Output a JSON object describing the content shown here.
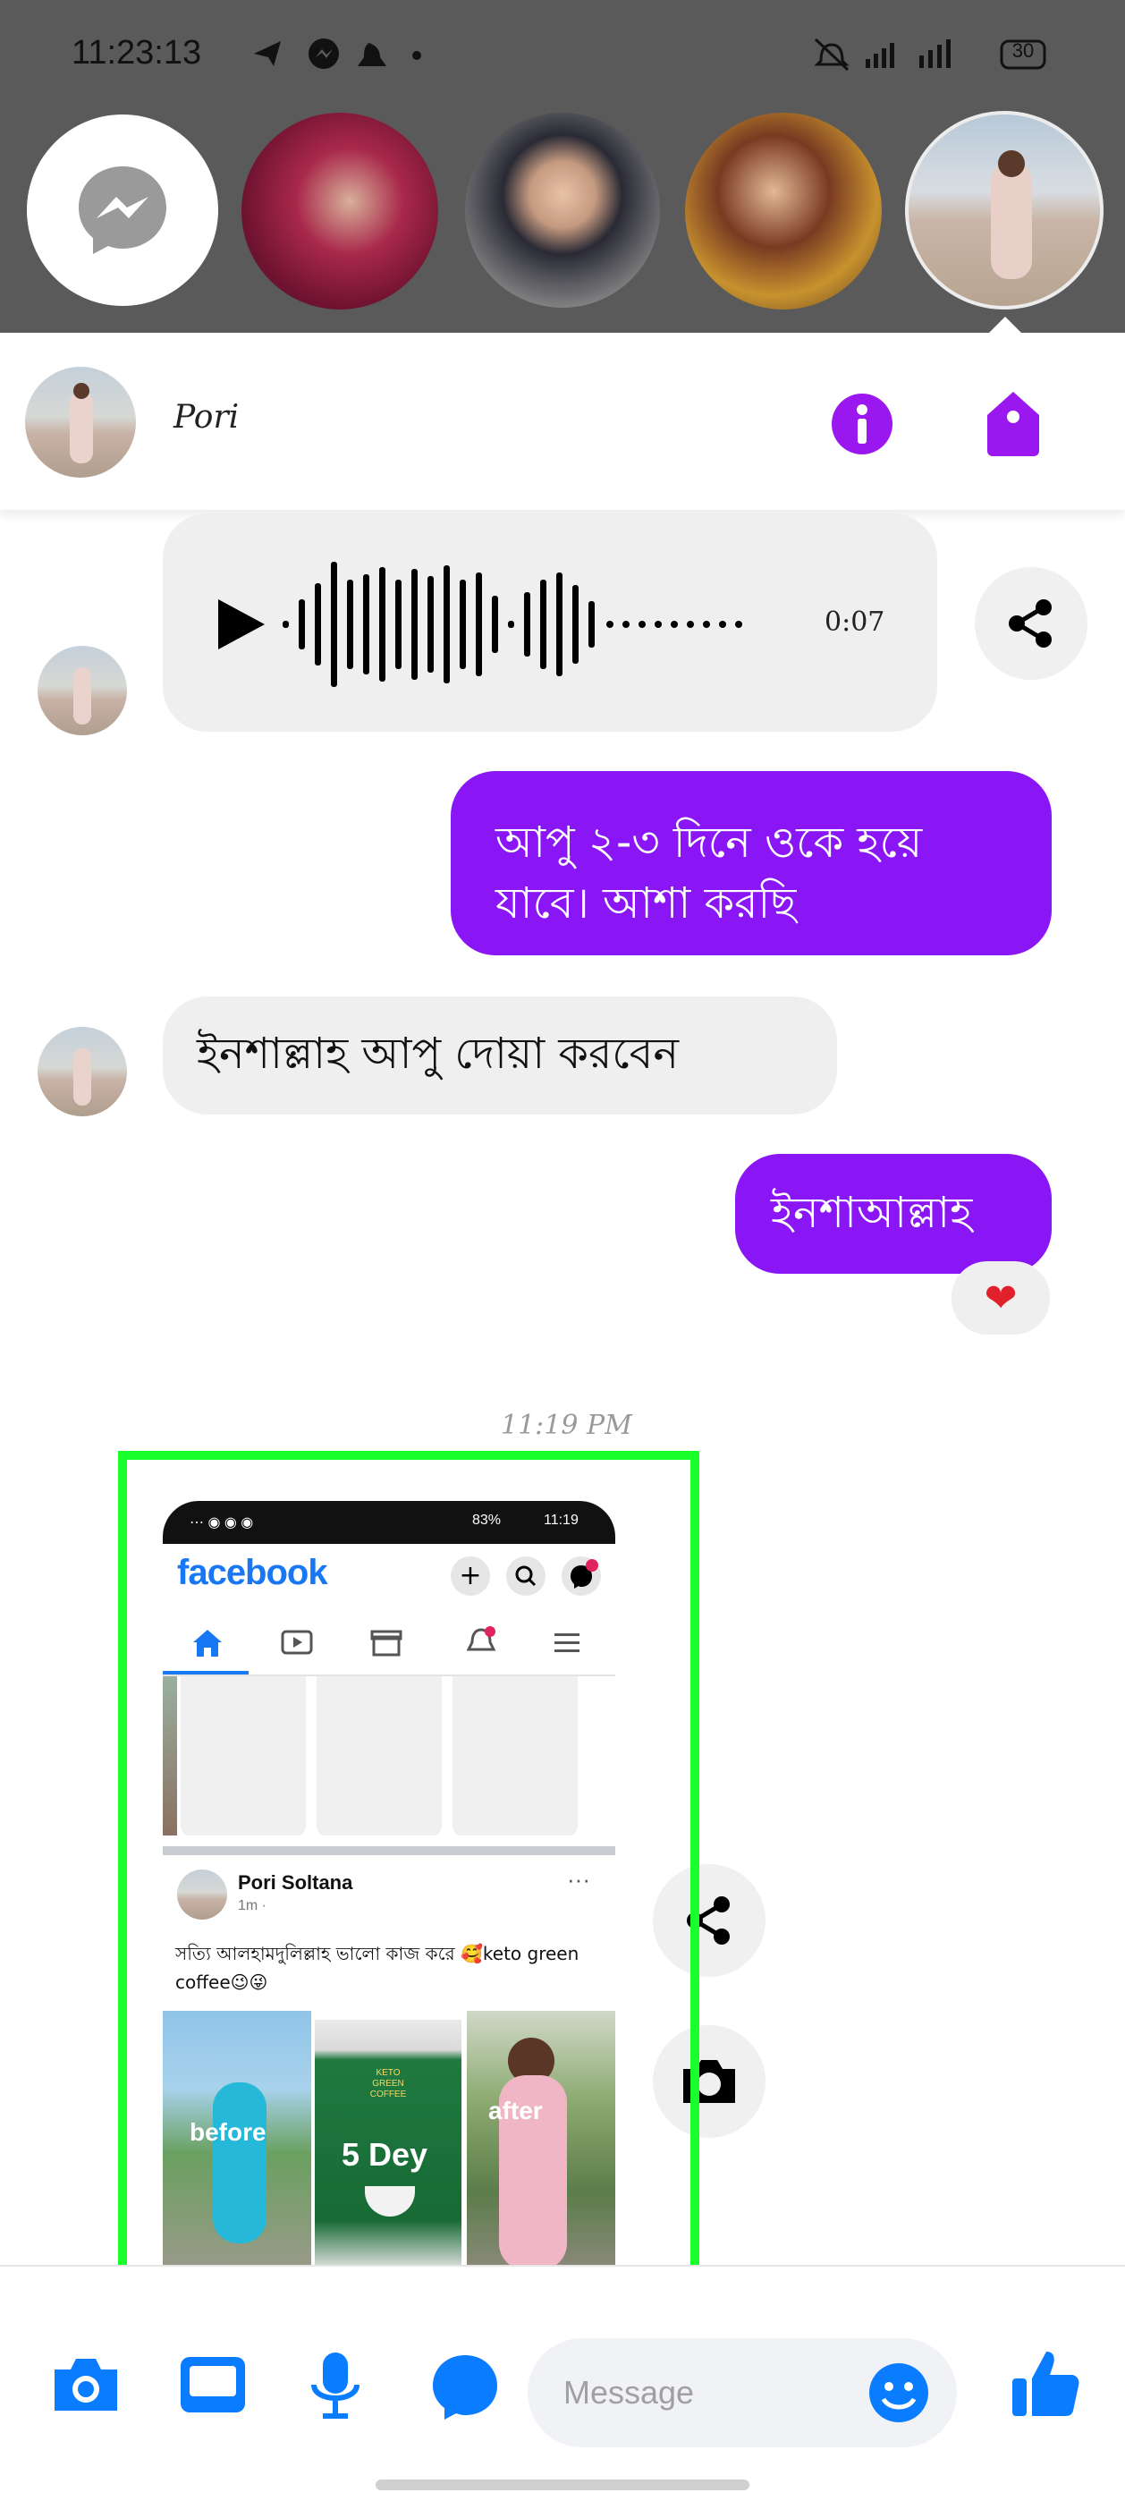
{
  "status_bar": {
    "time": "11:23:13",
    "battery": "30"
  },
  "chat": {
    "contact_name": "Pori",
    "voice_message": {
      "duration": "0:07"
    },
    "messages": [
      {
        "side": "out",
        "text": "আপু ২-৩ দিনে ওকে হয়ে যাবে। আশা করছি"
      },
      {
        "side": "in",
        "text": "ইনশাল্লাহ আপু দোয়া করবেন"
      },
      {
        "side": "out",
        "text": "ইনশাআল্লাহ",
        "reaction": "❤"
      }
    ],
    "timestamp": "11:19 PM"
  },
  "screenshot_preview": {
    "status_right": "83%",
    "status_time": "11:19",
    "app_name": "facebook",
    "post": {
      "author": "Pori Soltana",
      "meta": "1m ·",
      "text": "সত্যি আলহামদুলিল্লাহ ভালো কাজ করে 🥰keto green coffee😉😜",
      "images": [
        {
          "label": "before"
        },
        {
          "label": "5 Dey",
          "sublabel": "KETO GREEN COFFEE"
        },
        {
          "label": "after"
        }
      ]
    }
  },
  "composer": {
    "placeholder": "Message"
  },
  "colors": {
    "accent": "#8a16f5",
    "messenger_blue": "#0a7cff",
    "highlight_box": "#1aff2a"
  }
}
